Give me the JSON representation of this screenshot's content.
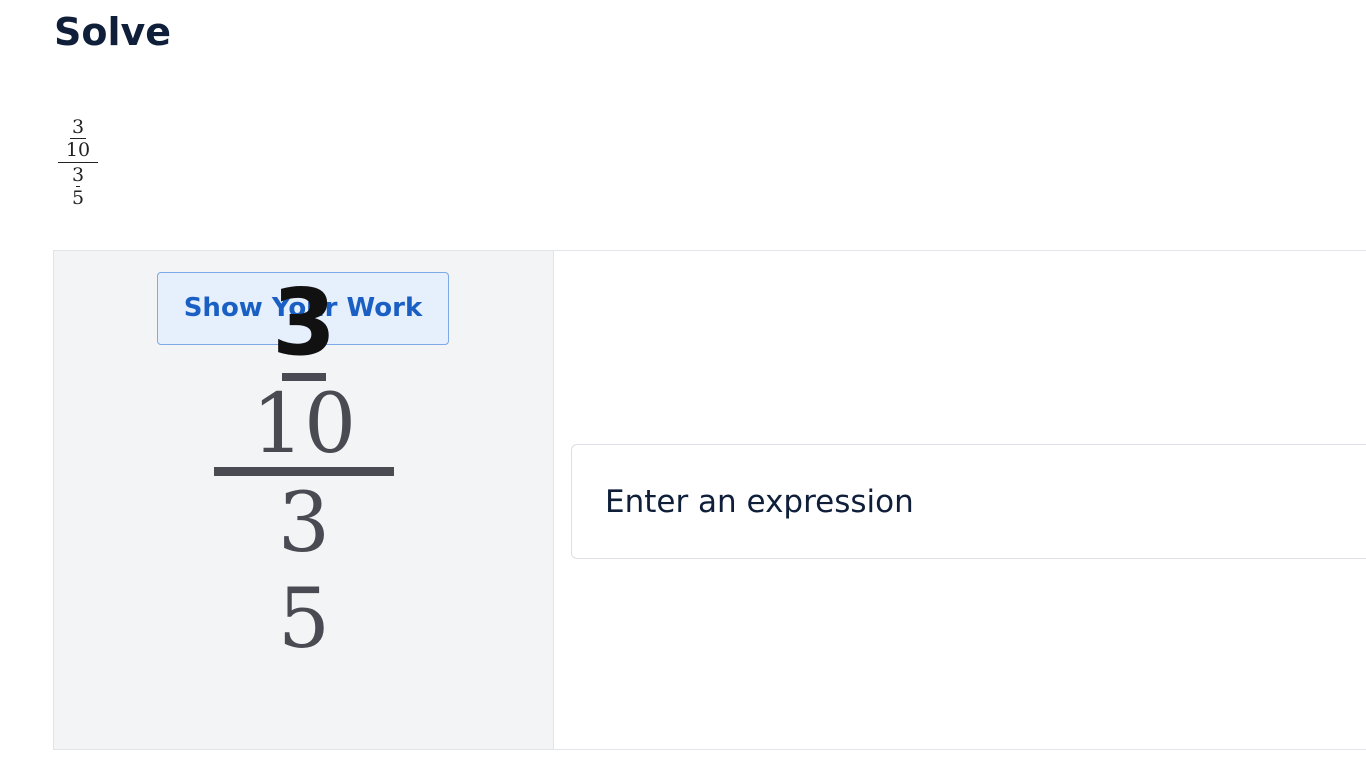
{
  "page": {
    "title": "Solve"
  },
  "problem": {
    "inner_numerator": "3",
    "inner_denominator": "10",
    "outer_numerator": "3",
    "outer_denominator": "5"
  },
  "work_panel": {
    "show_work_label": "Show Your Work",
    "handwritten_numerator": "3",
    "inner_denominator": "10",
    "outer_numerator": "3",
    "outer_denominator": "5"
  },
  "answer": {
    "placeholder": "Enter an expression",
    "value": ""
  }
}
